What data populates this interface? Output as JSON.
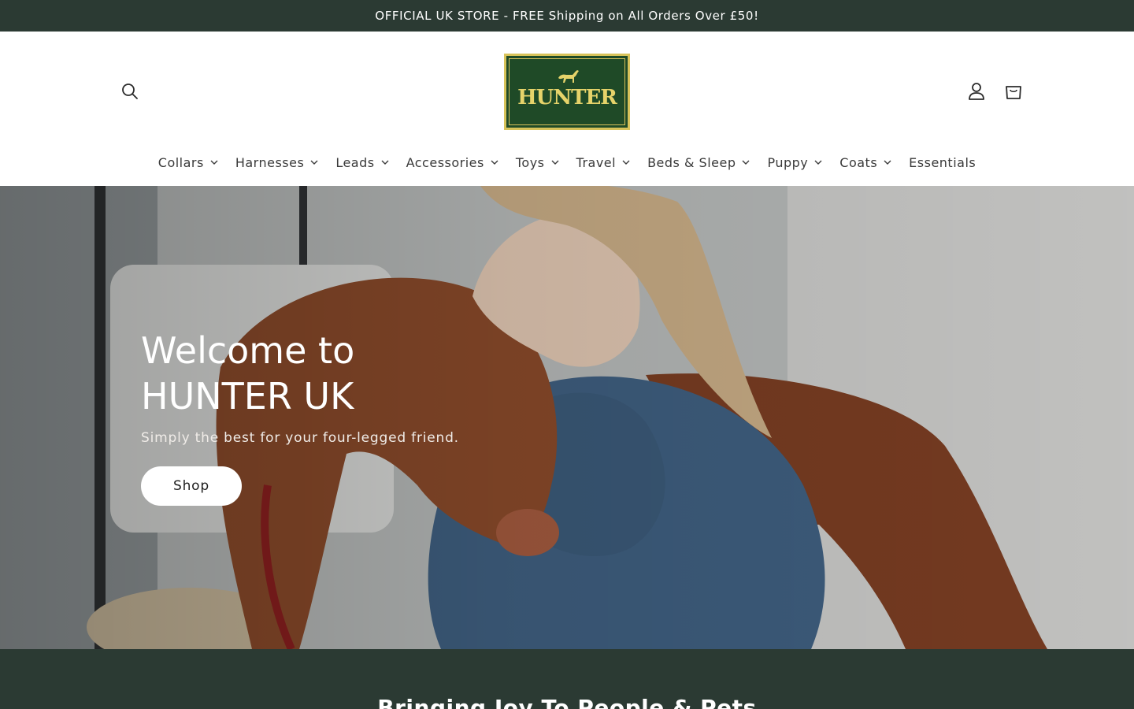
{
  "announcement": {
    "text": "OFFICIAL UK STORE - FREE Shipping on All Orders Over £50!"
  },
  "header": {
    "logo_text": "HUNTER",
    "search_icon": "search-icon",
    "account_icon": "user-icon",
    "cart_icon": "cart-icon"
  },
  "nav": {
    "items": [
      {
        "label": "Collars",
        "has_dropdown": true
      },
      {
        "label": "Harnesses",
        "has_dropdown": true
      },
      {
        "label": "Leads",
        "has_dropdown": true
      },
      {
        "label": "Accessories",
        "has_dropdown": true
      },
      {
        "label": "Toys",
        "has_dropdown": true
      },
      {
        "label": "Travel",
        "has_dropdown": true
      },
      {
        "label": "Beds & Sleep",
        "has_dropdown": true
      },
      {
        "label": "Puppy",
        "has_dropdown": true
      },
      {
        "label": "Coats",
        "has_dropdown": true
      },
      {
        "label": "Essentials",
        "has_dropdown": false
      }
    ]
  },
  "hero": {
    "title": "Welcome to HUNTER UK",
    "subtitle": "Simply the best for your four-legged friend.",
    "button_label": "Shop"
  },
  "section": {
    "title": "Bringing Joy To People & Pets"
  },
  "colors": {
    "brand_dark": "#2b3a33",
    "logo_green": "#1f4a27",
    "logo_gold": "#d8c35a",
    "dog_brown": "#8a4a2a",
    "denim": "#3f5f80"
  }
}
